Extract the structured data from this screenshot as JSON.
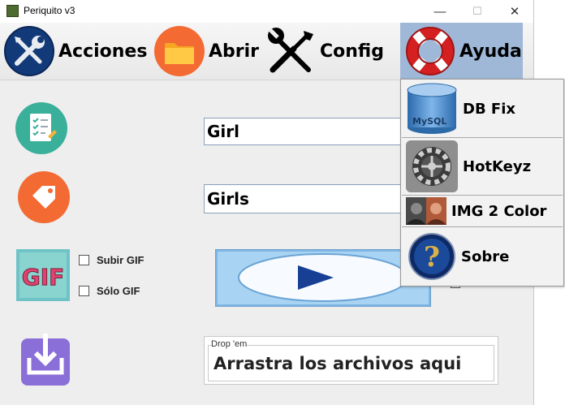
{
  "window": {
    "title": "Periquito v3",
    "minimize": "—",
    "maximize": "☐",
    "close": "✕"
  },
  "menu": {
    "acciones": "Acciones",
    "abrir": "Abrir",
    "config": "Config",
    "ayuda": "Ayuda"
  },
  "fields": {
    "tag_input": "Girl",
    "board_input": "Girls"
  },
  "options": {
    "subir_gif": "Subir GIF",
    "solo_gif": "Sólo GIF"
  },
  "drop_zone": {
    "legend": "Drop 'em",
    "text": "Arrastra los archivos aqui"
  },
  "ayuda_menu": {
    "items": [
      "DB Fix",
      "HotKeyz",
      "IMG 2 Color",
      "Sobre"
    ],
    "mysql_logo": "MySQL"
  },
  "icons": {
    "logo_text": "GIF",
    "accent_teal": "#3aaf9a",
    "accent_orange": "#f36a33",
    "accent_purple": "#8b6fd8",
    "accent_navy": "#123a78",
    "menu_highlight": "#9fb8d8"
  }
}
